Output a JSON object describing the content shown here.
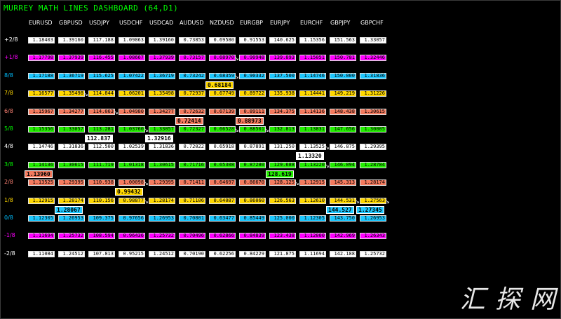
{
  "title": "MURREY MATH LINES DASHBOARD (64,D1)",
  "watermark": "汇探网",
  "symbols": [
    "EURUSD",
    "GBPUSD",
    "USDJPY",
    "USDCHF",
    "USDCAD",
    "AUDUSD",
    "NZDUSD",
    "EURGBP",
    "EURJPY",
    "EURCHF",
    "GBPJPY",
    "GBPCHF"
  ],
  "levels": [
    {
      "label": "+2/8",
      "color": "#ffffff",
      "cell_bg": "#ffffff",
      "values": [
        "1.18403",
        "1.39160",
        "117.188",
        "1.09863",
        "1.39160",
        "0.73853",
        "0.69580",
        "0.91553",
        "140.625",
        "1.15356",
        "151.563",
        "1.33057"
      ]
    },
    {
      "label": "+1/8",
      "color": "#ff00ff",
      "cell_bg": "#ff00ff",
      "values": [
        "1.17798",
        "1.37939",
        "116.455",
        "1.08667",
        "1.37939",
        "0.73157",
        "0.68970",
        "0.90948",
        "139.893",
        "1.15051",
        "150.781",
        "1.32446"
      ]
    },
    {
      "label": "8/8",
      "color": "#00bfff",
      "cell_bg": "#1ec8ff",
      "values": [
        "1.17188",
        "1.36719",
        "115.625",
        "1.07422",
        "1.36719",
        "0.73242",
        "0.68359",
        "0.90332",
        "137.500",
        "1.14746",
        "150.000",
        "1.31836"
      ]
    },
    {
      "label": "7/8",
      "color": "#ffd700",
      "cell_bg": "#ffd700",
      "values": [
        "1.16577",
        "1.35498",
        "114.844",
        "1.06201",
        "1.35498",
        "0.72937",
        "0.67749",
        "0.89722",
        "135.938",
        "1.14441",
        "149.219",
        "1.31226"
      ]
    },
    {
      "label": "6/8",
      "color": "#fa8072",
      "cell_bg": "#f47a5e",
      "values": [
        "1.15967",
        "1.34277",
        "114.063",
        "1.04980",
        "1.34277",
        "0.72632",
        "0.67139",
        "0.89111",
        "134.375",
        "1.14136",
        "148.438",
        "1.30615"
      ]
    },
    {
      "label": "5/8",
      "color": "#00ff00",
      "cell_bg": "#22ee00",
      "values": [
        "1.15356",
        "1.33057",
        "113.281",
        "1.03760",
        "1.33057",
        "0.72327",
        "0.66528",
        "0.88501",
        "132.813",
        "1.13831",
        "147.656",
        "1.30005"
      ]
    },
    {
      "label": "4/8",
      "color": "#ffffff",
      "cell_bg": "#ffffff",
      "values": [
        "1.14746",
        "1.31836",
        "112.500",
        "1.02539",
        "1.31836",
        "0.72022",
        "0.65918",
        "0.87891",
        "131.250",
        "1.13525",
        "146.875",
        "1.29395"
      ]
    },
    {
      "label": "3/8",
      "color": "#00ff00",
      "cell_bg": "#22ee00",
      "values": [
        "1.14136",
        "1.30615",
        "111.719",
        "1.01318",
        "1.30615",
        "0.71716",
        "0.65308",
        "0.87280",
        "129.688",
        "1.13220",
        "146.094",
        "1.28784"
      ]
    },
    {
      "label": "2/8",
      "color": "#fa8072",
      "cell_bg": "#f47a5e",
      "values": [
        "1.13525",
        "1.29395",
        "110.938",
        "1.00098",
        "1.29395",
        "0.71411",
        "0.64697",
        "0.86670",
        "128.125",
        "1.12915",
        "145.313",
        "1.28174"
      ]
    },
    {
      "label": "1/8",
      "color": "#ffd700",
      "cell_bg": "#ffd700",
      "values": [
        "1.12915",
        "1.28174",
        "110.156",
        "0.98877",
        "1.28174",
        "0.71106",
        "0.64087",
        "0.86060",
        "126.563",
        "1.12610",
        "144.531",
        "1.27563"
      ]
    },
    {
      "label": "0/8",
      "color": "#00bfff",
      "cell_bg": "#1ec8ff",
      "values": [
        "1.12305",
        "1.26953",
        "109.375",
        "0.97656",
        "1.26953",
        "0.70801",
        "0.63477",
        "0.85449",
        "125.000",
        "1.12305",
        "143.750",
        "1.26953"
      ]
    },
    {
      "label": "-1/8",
      "color": "#ff00ff",
      "cell_bg": "#ff00ff",
      "values": [
        "1.11694",
        "1.25732",
        "108.594",
        "0.96436",
        "1.25732",
        "0.70496",
        "0.62866",
        "0.84839",
        "123.438",
        "1.12000",
        "142.969",
        "1.26343"
      ]
    },
    {
      "label": "-2/8",
      "color": "#ffffff",
      "cell_bg": "#ffffff",
      "values": [
        "1.11084",
        "1.24512",
        "107.813",
        "0.95215",
        "1.24512",
        "0.70190",
        "0.62256",
        "0.84229",
        "121.875",
        "1.11694",
        "142.188",
        "1.25732"
      ]
    }
  ],
  "arrows": [
    {
      "col": 1,
      "level": 3
    },
    {
      "col": 2,
      "level": 4
    },
    {
      "col": 3,
      "level": 5
    },
    {
      "col": 6,
      "level": 1
    },
    {
      "col": 6,
      "level": 2
    },
    {
      "col": 6,
      "level": 5
    },
    {
      "col": 7,
      "level": 5
    },
    {
      "col": 8,
      "level": 8
    },
    {
      "col": 9,
      "level": 6
    },
    {
      "col": 9,
      "level": 7
    },
    {
      "col": 3,
      "level": 8
    },
    {
      "col": 3,
      "level": 9
    },
    {
      "col": 11,
      "level": 9
    },
    {
      "col": 10,
      "level": 9
    }
  ],
  "prices": [
    {
      "col": 0,
      "between": 7,
      "value": "1.13960",
      "bg": "#f47a5e"
    },
    {
      "col": 1,
      "between": 9,
      "value": "1.28067",
      "bg": "#1ec8ff"
    },
    {
      "col": 2,
      "between": 5,
      "value": "112.837",
      "bg": "#ffffff"
    },
    {
      "col": 3,
      "between": 8,
      "value": "0.99432",
      "bg": "#ffd700"
    },
    {
      "col": 4,
      "between": 5,
      "value": "1.32916",
      "bg": "#ffffff"
    },
    {
      "col": 5,
      "between": 4,
      "value": "0.72414",
      "bg": "#f47a5e"
    },
    {
      "col": 6,
      "between": 2,
      "value": "0.68184",
      "bg": "#ffd700"
    },
    {
      "col": 7,
      "between": 4,
      "value": "0.88973",
      "bg": "#f47a5e"
    },
    {
      "col": 8,
      "between": 7,
      "value": "128.619",
      "bg": "#22ee00"
    },
    {
      "col": 9,
      "between": 6,
      "value": "1.13320",
      "bg": "#ffffff"
    },
    {
      "col": 10,
      "between": 9,
      "value": "144.527",
      "bg": "#1ec8ff"
    },
    {
      "col": 11,
      "between": 9,
      "value": "1.27345",
      "bg": "#1ec8ff"
    }
  ]
}
